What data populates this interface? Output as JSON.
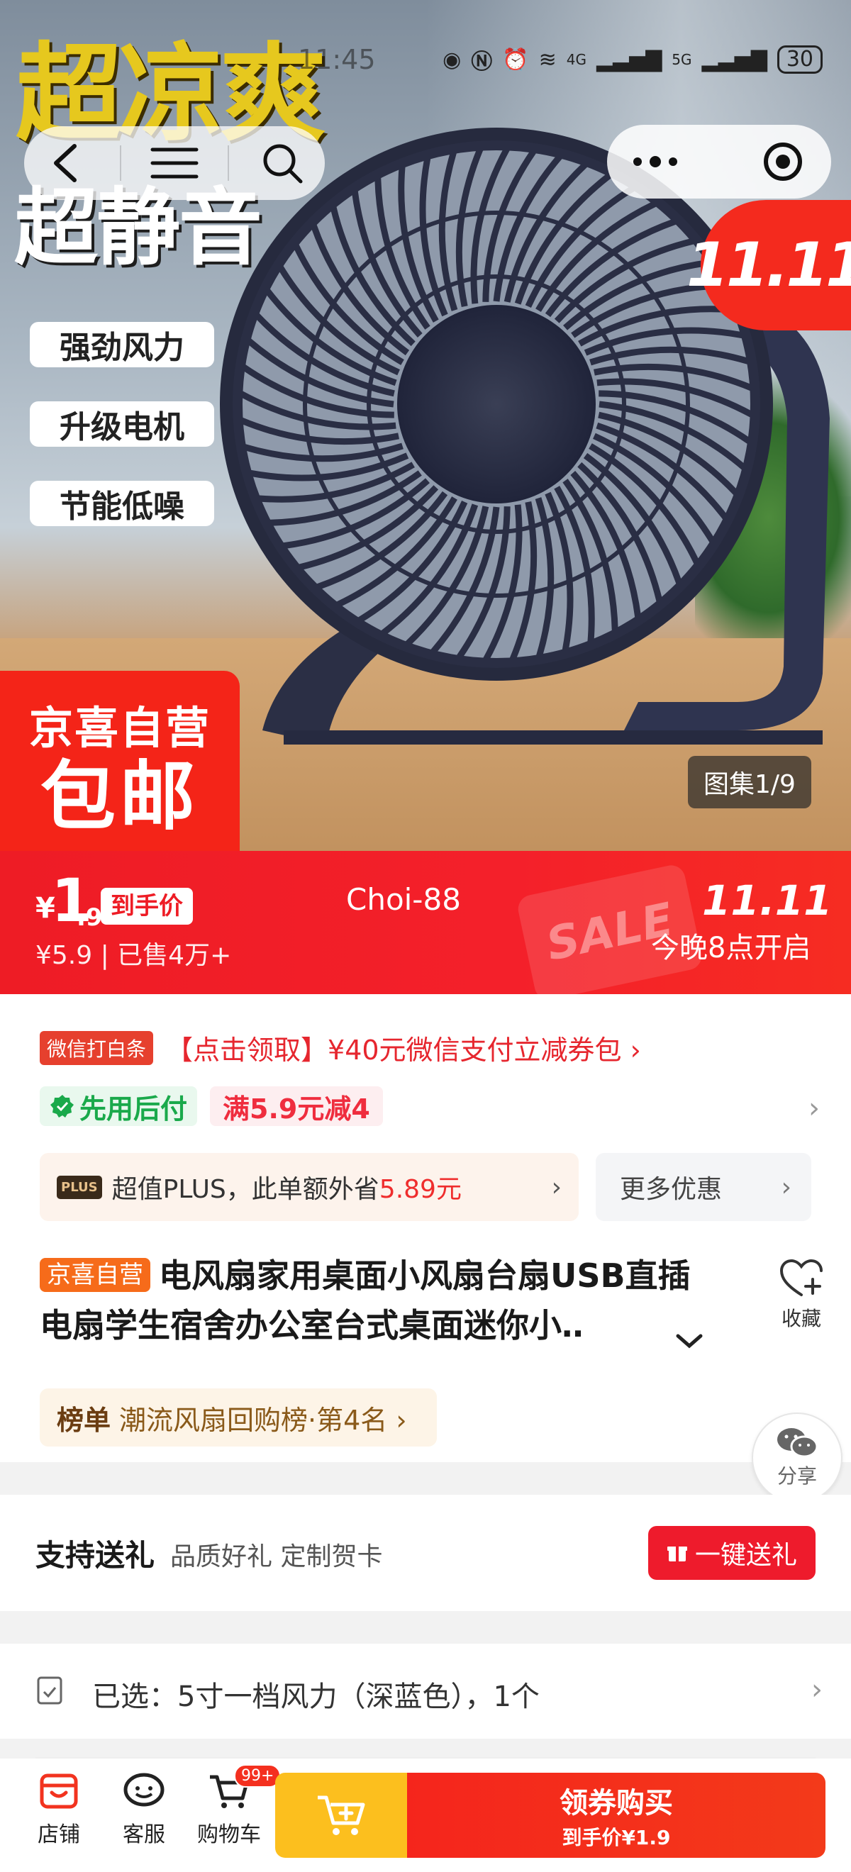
{
  "status_bar": {
    "time": "11:45",
    "network": "4G",
    "network2": "5G",
    "battery": "30"
  },
  "hero": {
    "promo_line1": "超凉爽",
    "promo_line2": "超静音",
    "features": [
      "强劲风力",
      "升级电机",
      "节能低噪"
    ],
    "eleven_logo": "11.11",
    "badge_top": "京喜自营",
    "badge_bottom": "包邮",
    "gallery_label": "图集1/9"
  },
  "price": {
    "currency": "¥",
    "integer": "1",
    "decimal": ".9",
    "tag": "到手价",
    "original_sold": "¥5.9 | 已售4万+",
    "shop_code": "Choi-88",
    "sale_stamp": "SALE",
    "event_logo": "11.11",
    "event_text": "今晚8点开启"
  },
  "wechat": {
    "tag": "微信打白条",
    "text": "【点击领取】¥40元微信支付立减券包 ›"
  },
  "bnpl": {
    "label": "先用后付",
    "coupon": "满5.9元减4"
  },
  "plus": {
    "logo": "PLUS",
    "text_prefix": "超值PLUS，此单额外省",
    "amount": "5.89元",
    "more": "更多优惠"
  },
  "product": {
    "self_tag": "京喜自营",
    "title": "电风扇家用桌面小风扇台扇USB直插电扇学生宿舍办公室台式桌面迷你小‥",
    "favorite": "收藏"
  },
  "rank": {
    "label": "榜单",
    "text": "潮流风扇回购榜·第4名 ›"
  },
  "share": {
    "label": "分享"
  },
  "gift": {
    "title": "支持送礼",
    "sub": "品质好礼 定制贺卡",
    "button": "一键送礼"
  },
  "selected": {
    "text": "已选：5寸一档风力（深蓝色），1个"
  },
  "bottom_bar": {
    "store": "店铺",
    "service": "客服",
    "cart": "购物车",
    "cart_badge": "99+",
    "buy_main": "领券购买",
    "buy_sub": "到手价¥1.9"
  },
  "colors": {
    "brand_red": "#ee1c25",
    "cart_yellow": "#fcbf1e",
    "bnpl_green": "#1aa94b",
    "jx_orange": "#f66b1a"
  }
}
